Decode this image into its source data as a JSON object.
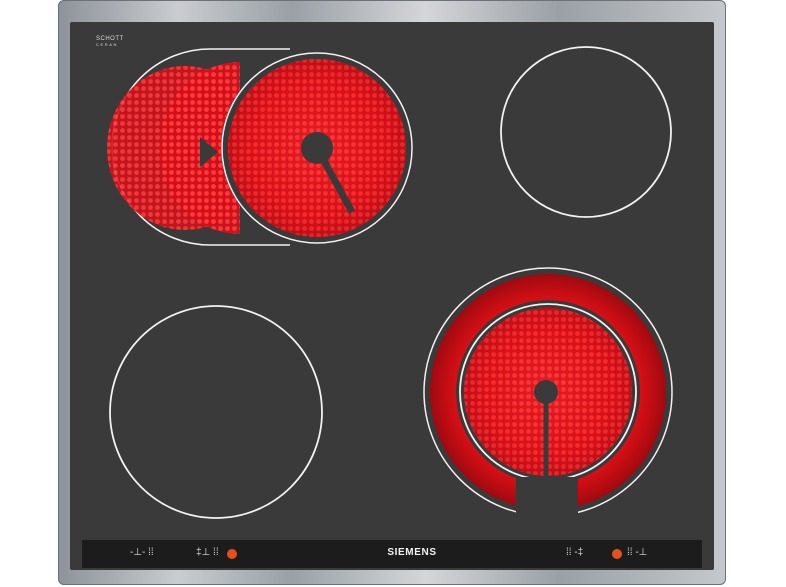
{
  "brand": "SIEMENS",
  "glass_brand": {
    "line1": "SCHOTT",
    "line2": "CERAN",
    "line3": ""
  },
  "controls": {
    "left_symbol_1": "-⊥- ⁞⁞",
    "left_symbol_2": "‡⊥ ⁞⁞",
    "right_symbol_1": "⁞⁞ -‡",
    "right_symbol_2": "⁞⁞ -⊥"
  },
  "colors": {
    "glass": "#3a3a3b",
    "heating": "#e5101a",
    "ring": "#f2f2f2",
    "indicator": "#e8501a",
    "frame": "#b9bcc0"
  },
  "zones": [
    {
      "name": "back-left-extended-zone",
      "state": "on"
    },
    {
      "name": "back-right-zone",
      "state": "off"
    },
    {
      "name": "front-left-zone",
      "state": "off"
    },
    {
      "name": "front-right-dual-zone",
      "state": "on"
    }
  ]
}
